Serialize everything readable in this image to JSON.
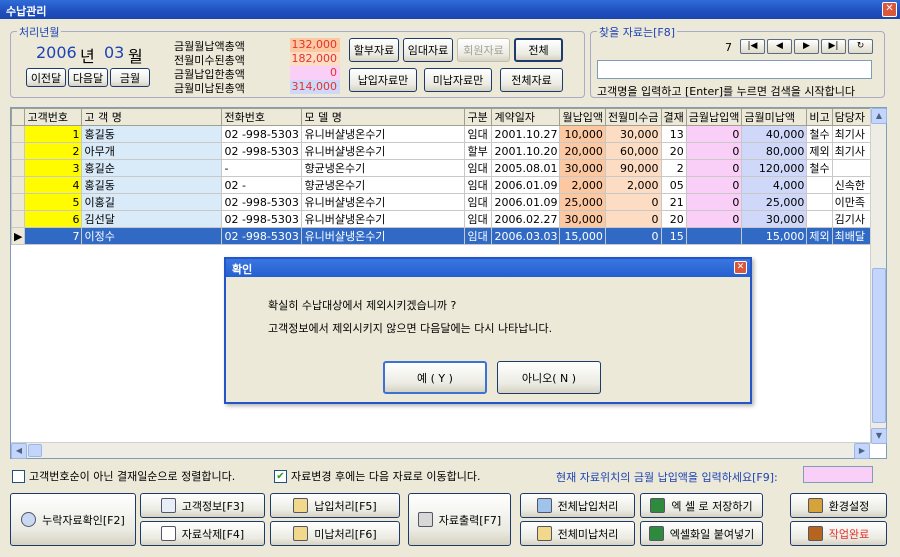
{
  "window": {
    "title": "수납관리",
    "close_glyph": "✕"
  },
  "period": {
    "title": "처리년월",
    "year": "2006",
    "year_unit": "년",
    "month": "03",
    "month_unit": "월",
    "prev_label": "이전달",
    "next_label": "다음달",
    "current_label": "금월"
  },
  "summary": [
    {
      "label": "금월월납액총액",
      "value": "132,000",
      "color": "#fcc8a2"
    },
    {
      "label": "전월미수된총액",
      "value": "182,000",
      "color": "#fcdcc2"
    },
    {
      "label": "금월납입한총액",
      "value": "0",
      "color": "#f9cef7"
    },
    {
      "label": "금월미납된총액",
      "value": "314,000",
      "color": "#cfd8f9"
    }
  ],
  "filters": {
    "installment": "할부자료",
    "rental": "임대자료",
    "member": "회원자료",
    "all": "전체",
    "paid_only": "납입자료만",
    "unpaid_only": "미납자료만",
    "all_data": "전체자료"
  },
  "search": {
    "title": "찾을 자료는[F8]",
    "count": "7",
    "nav": [
      "|◀",
      "◀",
      "▶",
      "▶|",
      "↻"
    ],
    "hint": "고객명을 입력하고 [Enter]를 누르면 검색을 시작합니다",
    "value": ""
  },
  "table": {
    "headers": [
      "고객번호",
      "고 객 명",
      "전화번호",
      "모 델 명",
      "구분",
      "계약일자",
      "월납입액",
      "전월미수금",
      "결재",
      "금월납입액",
      "금월미납액",
      "비고",
      "담당자"
    ],
    "rows": [
      [
        "1",
        "홍길동",
        "02 -998-5303",
        "유니버샬냉온수기",
        "임대",
        "2001.10.27",
        "10,000",
        "30,000",
        "13",
        "0",
        "40,000",
        "철수",
        "최기사"
      ],
      [
        "2",
        "아무개",
        "02 -998-5303",
        "유니버샬냉온수기",
        "할부",
        "2001.10.20",
        "20,000",
        "60,000",
        "20",
        "0",
        "80,000",
        "제외",
        "최기사"
      ],
      [
        "3",
        "홍길순",
        "    -",
        "향균냉온수기",
        "임대",
        "2005.08.01",
        "30,000",
        "90,000",
        "2",
        "0",
        "120,000",
        "철수",
        ""
      ],
      [
        "4",
        "홍길동",
        "02 -",
        "향균냉온수기",
        "임대",
        "2006.01.09",
        "2,000",
        "2,000",
        "05",
        "0",
        "4,000",
        "",
        "신속한"
      ],
      [
        "5",
        "이홍길",
        "02 -998-5303",
        "유니버샬냉온수기",
        "임대",
        "2006.01.09",
        "25,000",
        "0",
        "21",
        "0",
        "25,000",
        "",
        "이만족"
      ],
      [
        "6",
        "김선달",
        "02 -998-5303",
        "유니버샬냉온수기",
        "임대",
        "2006.02.27",
        "30,000",
        "0",
        "20",
        "0",
        "30,000",
        "",
        "김기사"
      ],
      [
        "7",
        "이정수",
        "02 -998-5303",
        "유니버샬냉온수기",
        "임대",
        "2006.03.03",
        "15,000",
        "0",
        "15",
        "",
        "15,000",
        "제외",
        "최배달"
      ]
    ],
    "row_marker": "▶"
  },
  "options": {
    "sort_label": "고객번호순이 아닌 결재일순으로 정렬합니다.",
    "sort_checked": false,
    "move_label": "자료변경 후에는 다음 자료로 이동합니다.",
    "move_checked": true,
    "input_prompt": "현재 자료위치의 금월 납입액을 입력하세요[F9]:",
    "input_value": ""
  },
  "actions": {
    "missing_check": "누락자료확인[F2]",
    "customer_info": "고객정보[F3]",
    "delete": "자료삭제[F4]",
    "pay": "납입처리[F5]",
    "unpay": "미납처리[F6]",
    "print": "자료출력[F7]",
    "pay_all": "전체납입처리",
    "unpay_all": "전체미납처리",
    "save_excel": "엑 셀 로 저장하기",
    "paste_excel": "엑셀화일 붙여넣기",
    "settings": "환경설정",
    "finish": "작업완료"
  },
  "dialog": {
    "title": "확인",
    "line1": "확실히 수납대상에서 제외시키겠습니까 ?",
    "line2": "고객정보에서 제외시키지 않으면 다음달에는 다시 나타납니다.",
    "yes": "예 ( Y )",
    "no": "아니오( N )"
  }
}
